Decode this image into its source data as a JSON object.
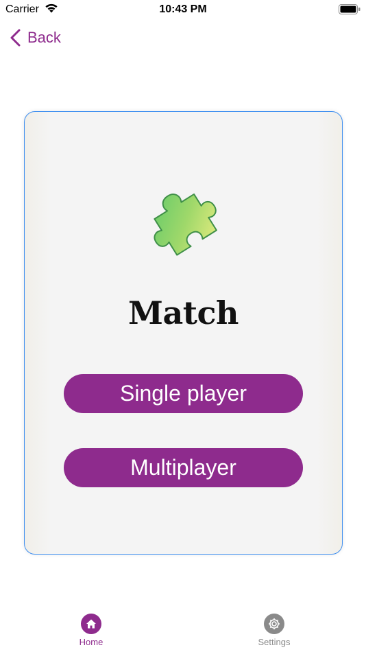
{
  "status_bar": {
    "carrier": "Carrier",
    "time": "10:43 PM",
    "wifi_icon": "wifi-icon",
    "battery_icon": "battery-icon"
  },
  "nav": {
    "back_label": "Back",
    "back_icon": "chevron-left-icon"
  },
  "card": {
    "icon": "puzzle-piece-icon",
    "title": "Match",
    "buttons": [
      {
        "label": "Single player"
      },
      {
        "label": "Multiplayer"
      }
    ]
  },
  "tab_bar": {
    "tabs": [
      {
        "label": "Home",
        "icon": "home-icon",
        "selected": true
      },
      {
        "label": "Settings",
        "icon": "gear-icon",
        "selected": false
      }
    ]
  },
  "colors": {
    "accent": "#8e2b8d",
    "card_border": "#3d8ef0",
    "inactive_tab": "#8a8a8a"
  }
}
